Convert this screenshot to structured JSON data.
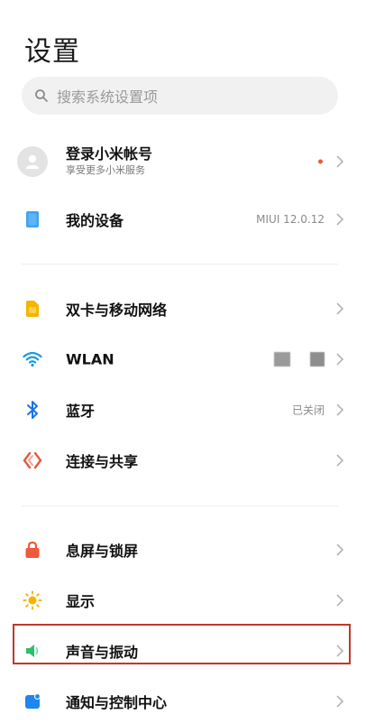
{
  "page": {
    "title": "设置"
  },
  "search": {
    "placeholder": "搜索系统设置项",
    "icon": "search-icon"
  },
  "account": {
    "title": "登录小米帐号",
    "subtitle": "享受更多小米服务",
    "status_dot_color": "#e85a3a"
  },
  "device": {
    "label": "我的设备",
    "value": "MIUI 12.0.12"
  },
  "network": [
    {
      "label": "双卡与移动网络",
      "icon": "sim-card-icon",
      "color": "#f5b400"
    },
    {
      "label": "WLAN",
      "icon": "wifi-icon",
      "color": "#1a9bd7"
    },
    {
      "label": "蓝牙",
      "value": "已关闭",
      "icon": "bluetooth-icon",
      "color": "#1a73e8"
    },
    {
      "label": "连接与共享",
      "icon": "share-icon",
      "color": "#e8563f"
    }
  ],
  "system": [
    {
      "label": "息屏与锁屏",
      "icon": "lock-icon",
      "color": "#ee5a3a"
    },
    {
      "label": "显示",
      "icon": "brightness-icon",
      "color": "#f5b400"
    },
    {
      "label": "声音与振动",
      "icon": "speaker-icon",
      "color": "#2dbf6e"
    },
    {
      "label": "通知与控制中心",
      "icon": "notification-icon",
      "color": "#1e86f0"
    }
  ],
  "highlight_color": "#c0392b"
}
